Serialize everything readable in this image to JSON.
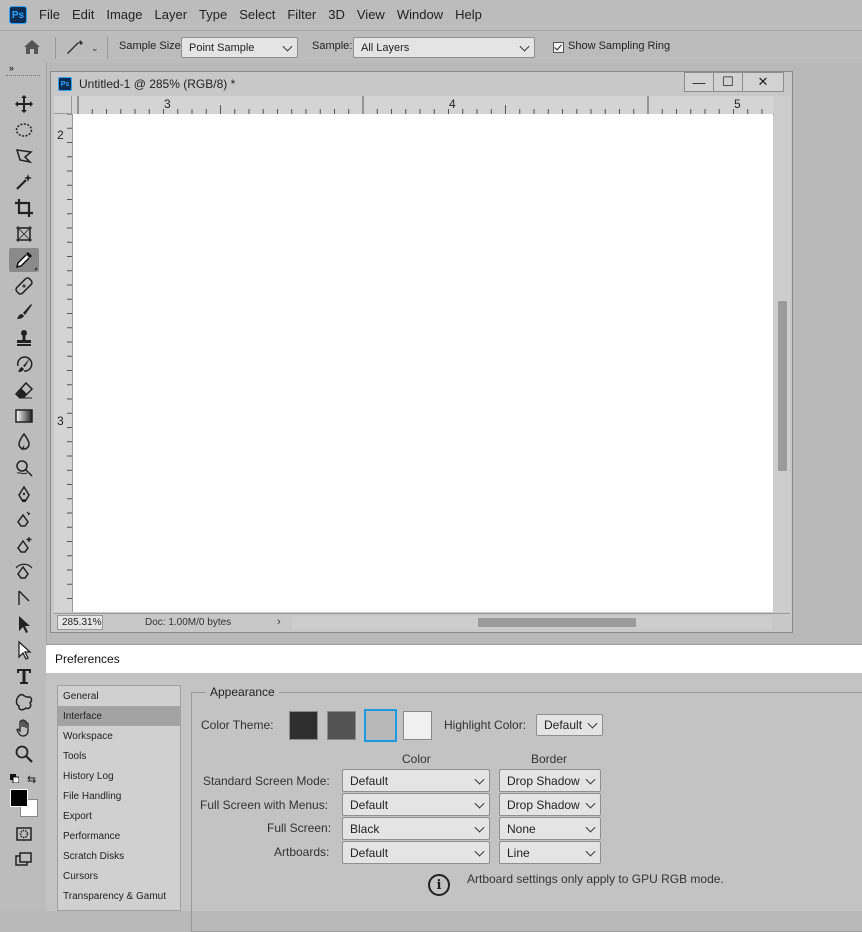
{
  "menubar": {
    "logo": "Ps",
    "items": [
      "File",
      "Edit",
      "Image",
      "Layer",
      "Type",
      "Select",
      "Filter",
      "3D",
      "View",
      "Window",
      "Help"
    ]
  },
  "options": {
    "sample_size_label": "Sample Size:",
    "sample_size_value": "Point Sample",
    "sample_label": "Sample:",
    "sample_value": "All Layers",
    "show_ring_label": "Show Sampling Ring",
    "show_ring_checked": true
  },
  "toolbar": {
    "collapse": "»",
    "tools": [
      "move-tool",
      "marquee-tool",
      "lasso-tool",
      "magic-wand-tool",
      "crop-tool",
      "frame-tool",
      "eyedropper-tool",
      "healing-tool",
      "brush-tool",
      "clone-stamp-tool",
      "history-brush-tool",
      "eraser-tool",
      "gradient-tool",
      "blur-tool",
      "dodge-tool",
      "pen-tool",
      "freeform-pen-tool",
      "add-anchor-tool",
      "curvature-pen-tool",
      "path-select-tool",
      "direct-select-tool",
      "arrow-tool",
      "type-tool",
      "custom-shape-tool",
      "hand-tool",
      "zoom-tool"
    ],
    "active_tool": "eyedropper-tool",
    "foreground_color": "#000000",
    "background_color": "#ffffff"
  },
  "document": {
    "logo": "Ps",
    "title": "Untitled-1 @ 285% (RGB/8) *",
    "ruler_h": [
      "3",
      "4",
      "5"
    ],
    "ruler_v": [
      "2",
      "3"
    ],
    "zoom": "285.31%",
    "doc_info": "Doc: 1.00M/0 bytes",
    "status_arrow": "›",
    "minimize": "—",
    "maximize": "☐",
    "close": "✕"
  },
  "preferences": {
    "title": "Preferences",
    "categories": [
      "General",
      "Interface",
      "Workspace",
      "Tools",
      "History Log",
      "File Handling",
      "Export",
      "Performance",
      "Scratch Disks",
      "Cursors",
      "Transparency & Gamut"
    ],
    "selected_category": "Interface",
    "appearance": {
      "legend": "Appearance",
      "color_theme_label": "Color Theme:",
      "themes": [
        "#2f2f2f",
        "#535353",
        "#b8b8b8",
        "#f0f0f0"
      ],
      "selected_theme_index": 2,
      "highlight_label": "Highlight Color:",
      "highlight_value": "Default",
      "col_color": "Color",
      "col_border": "Border",
      "rows": [
        {
          "label": "Standard Screen Mode:",
          "color": "Default",
          "border": "Drop Shadow"
        },
        {
          "label": "Full Screen with Menus:",
          "color": "Default",
          "border": "Drop Shadow"
        },
        {
          "label": "Full Screen:",
          "color": "Black",
          "border": "None"
        },
        {
          "label": "Artboards:",
          "color": "Default",
          "border": "Line"
        }
      ],
      "hint": "Artboard settings only apply to GPU RGB mode."
    }
  }
}
